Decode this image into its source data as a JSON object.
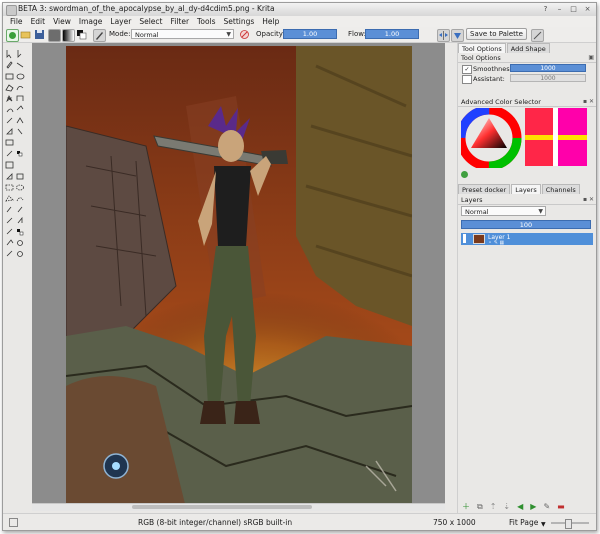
{
  "window": {
    "title": "BETA 3: swordman_of_the_apocalypse_by_al_dy-d4cdim5.png - Krita",
    "controls": [
      "?",
      "–",
      "□",
      "×"
    ]
  },
  "menu": [
    "File",
    "Edit",
    "View",
    "Image",
    "Layer",
    "Select",
    "Filter",
    "Tools",
    "Settings",
    "Help"
  ],
  "toolbar": {
    "mode_label": "Mode:",
    "mode_value": "Normal",
    "opacity_label": "Opacity:",
    "opacity_value": "1.00",
    "flow_label": "Flow:",
    "flow_value": "1.00",
    "save_palette_label": "Save to Palette"
  },
  "dock": {
    "tabs_top": [
      "Tool Options",
      "Add Shape"
    ],
    "tool_options_title": "Tool Options",
    "smoothness_label": "Smoothness:",
    "smoothness_value": "1000",
    "assistant_label": "Assistant:",
    "assistant_value": "1000",
    "color_selector_title": "Advanced Color Selector",
    "tabs_bottom": [
      "Preset docker",
      "Layers",
      "Channels"
    ],
    "layers_title": "Layers",
    "blend_mode": "Normal",
    "layer_opacity": "100",
    "layers": [
      {
        "name": "Layer 1"
      }
    ]
  },
  "status": {
    "color_model": "RGB (8-bit integer/channel)  sRGB built-in",
    "image_size": "750 x 1000",
    "zoom_mode": "Fit Page"
  },
  "colors": {
    "slider_blue": "#5b8fd6",
    "selection_blue": "#4f8fd9",
    "sky_top": "#6a2a14",
    "sky_bottom": "#c35a1c"
  }
}
